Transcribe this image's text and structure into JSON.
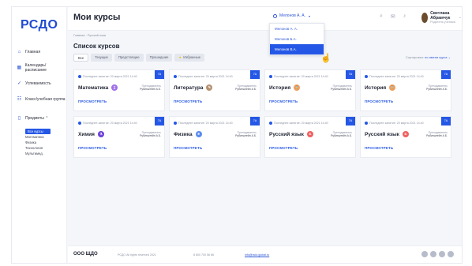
{
  "app": {
    "logo": "РСДО"
  },
  "sidebar": {
    "items": [
      {
        "icon": "home-icon",
        "glyph": "⌂",
        "label": "Главная"
      },
      {
        "icon": "calendar-icon",
        "glyph": "▦",
        "label": "Календарь/расписание"
      },
      {
        "icon": "progress-icon",
        "glyph": "✓",
        "label": "Успеваемость"
      },
      {
        "icon": "users-icon",
        "glyph": "☷",
        "label": "Класс/учебная группа"
      },
      {
        "icon": "book-icon",
        "glyph": "▯",
        "label": "Предметы ⌃"
      }
    ],
    "subjects": [
      "Все курсы",
      "Математика",
      "Физика",
      "Технология",
      "Мультимед."
    ]
  },
  "header": {
    "title": "Мои курсы",
    "group_selected": "Мелонов А. А.",
    "user_name": "Светлана Абрамчук",
    "user_role": "Родитель ученика"
  },
  "dropdown": {
    "options": [
      "Мелонов А. А.",
      "Мелонов Б.А.",
      "Мелонов В.А."
    ],
    "selected_index": 2
  },
  "breadcrumb": "Главная · Русский язык",
  "section_title": "Список курсов",
  "filters": [
    "Все",
    "Текущие",
    "Предстоящие",
    "Прошедшие",
    "Избранные"
  ],
  "sort": {
    "label": "Сортировка:",
    "value": "по имени курса ⌄"
  },
  "card_common": {
    "date": "Последнее занятие: 20 марта 2021 14:40",
    "teacher_label": "Преподаватель",
    "teacher": "Рубинштейн А.Б.",
    "badge": "7А",
    "view": "ПРОСМОТРЕТЬ"
  },
  "courses": [
    {
      "subject": "Математика",
      "color": "#a070e8",
      "glyph": "∑"
    },
    {
      "subject": "Литература",
      "color": "#b59273",
      "glyph": "✎"
    },
    {
      "subject": "История",
      "color": "#f0a060",
      "glyph": "⌛"
    },
    {
      "subject": "История",
      "color": "#f0a060",
      "glyph": "⌛"
    },
    {
      "subject": "Химия",
      "color": "#6b3fd6",
      "glyph": "⚗"
    },
    {
      "subject": "Физика",
      "color": "#5a8af0",
      "glyph": "⚛"
    },
    {
      "subject": "Русский язык",
      "color": "#f06060",
      "glyph": "Б"
    },
    {
      "subject": "Русский язык",
      "color": "#f06060",
      "glyph": "Б"
    }
  ],
  "footer": {
    "company": "ООО ЩДО",
    "rights": "РСДО All rights reserved 2021",
    "phone": "8 800 700 56 66",
    "email": "info@rsdo.global.ru"
  }
}
